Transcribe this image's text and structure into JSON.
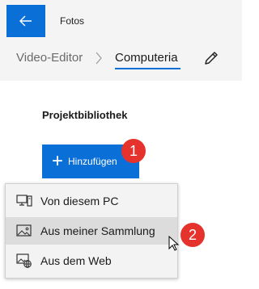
{
  "app": {
    "title": "Fotos"
  },
  "breadcrumb": {
    "root": "Video-Editor",
    "current": "Computeria"
  },
  "library": {
    "title": "Projektbibliothek",
    "add_label": "Hinzufügen"
  },
  "badges": {
    "one": "1",
    "two": "2"
  },
  "menu": {
    "items": [
      {
        "label": "Von diesem PC",
        "icon": "computer-icon"
      },
      {
        "label": "Aus meiner Sammlung",
        "icon": "image-icon"
      },
      {
        "label": "Aus dem Web",
        "icon": "web-image-icon"
      }
    ]
  },
  "colors": {
    "accent": "#0a6fd6",
    "badge": "#e5322d"
  }
}
